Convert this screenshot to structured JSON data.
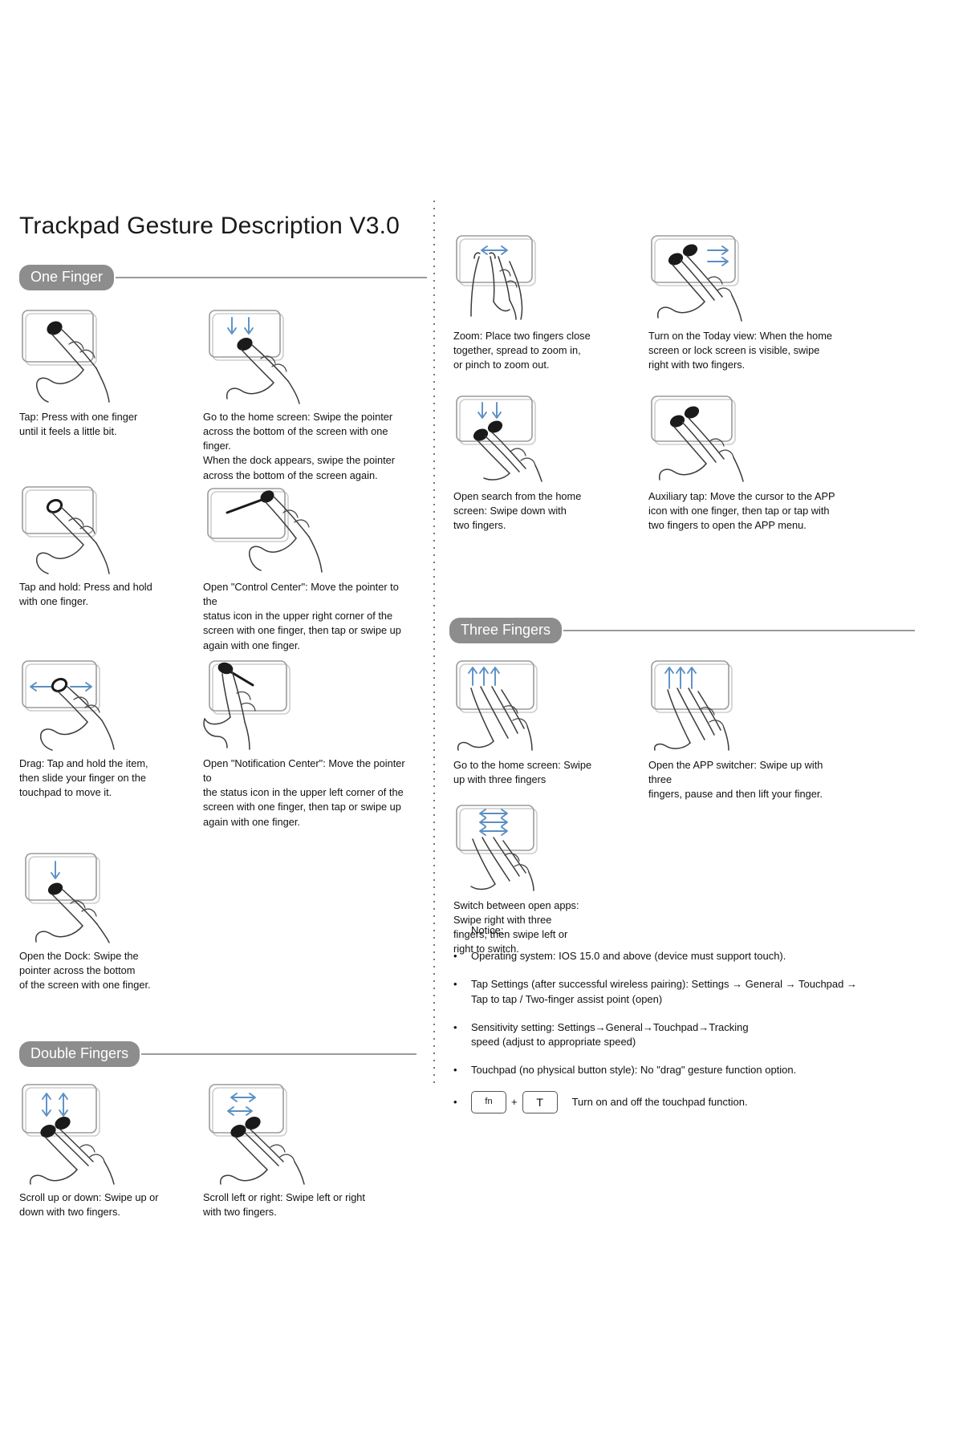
{
  "document": {
    "title": "Trackpad Gesture Description V3.0"
  },
  "sections": {
    "one_finger": {
      "label": "One Finger",
      "items": [
        {
          "caption": "Tap: Press with one finger\nuntil it feels a little bit."
        },
        {
          "caption": "Go to the home screen: Swipe the pointer\nacross the bottom of the screen with one finger.\nWhen the dock appears, swipe the pointer\nacross the bottom of the screen again."
        },
        {
          "caption": "Tap and hold: Press and hold\nwith one finger."
        },
        {
          "caption": "Open \"Control Center\": Move the pointer to the\nstatus icon in the upper right corner of the\nscreen with one finger, then tap or swipe up\nagain with one finger."
        },
        {
          "caption": "Drag: Tap and hold the item,\nthen slide your finger on the\ntouchpad to move it."
        },
        {
          "caption": "Open \"Notification Center\": Move the pointer to\nthe status icon in the upper left corner of the\nscreen with one finger, then tap or swipe up\nagain with one finger."
        },
        {
          "caption": "Open the Dock: Swipe the\npointer across the bottom\nof the screen with one finger."
        }
      ]
    },
    "double_fingers": {
      "label": "Double Fingers",
      "items": [
        {
          "caption": "Scroll up or down: Swipe up or\ndown with two fingers."
        },
        {
          "caption": "Scroll left or right: Swipe left or right\nwith two fingers."
        },
        {
          "caption": "Zoom: Place two fingers close\ntogether, spread to zoom in,\nor pinch to zoom out."
        },
        {
          "caption": "Turn on the Today view: When the home\nscreen or lock screen is visible, swipe\nright with two fingers."
        },
        {
          "caption": "Open search from the home\nscreen: Swipe down with\ntwo fingers."
        },
        {
          "caption": "Auxiliary tap: Move the cursor to the APP\nicon with one finger, then tap or tap with\ntwo fingers to open the APP menu."
        }
      ]
    },
    "three_fingers": {
      "label": "Three Fingers",
      "items": [
        {
          "caption": "Go to the home screen: Swipe\nup with three fingers"
        },
        {
          "caption": "Open the APP switcher: Swipe up with three\nfingers, pause and then lift your finger."
        },
        {
          "caption": "Switch between open apps:\nSwipe right with three\nfingers, then swipe left or\nright to switch."
        }
      ]
    }
  },
  "notice": {
    "title": "Notice:",
    "bullet": "•",
    "items": [
      "Operating system: IOS 15.0 and above (device must support touch).",
      "Tap Settings (after successful wireless pairing): Settings → General → Touchpad →\nTap to tap / Two-finger assist point (open)",
      "Sensitivity setting: Settings→General→Touchpad→Tracking\nspeed (adjust to appropriate speed)",
      "Touchpad (no physical button style): No \"drag\" gesture function option."
    ],
    "shortcut": {
      "key1": "fn",
      "plus": "+",
      "key2": "T",
      "label": "Turn on and off the touchpad function."
    }
  },
  "colors": {
    "pill": "#8d8d8d",
    "arrow": "#5b8fc4",
    "outline": "#3b3b3b",
    "pad": "#9b9b9b",
    "text": "#111111"
  }
}
